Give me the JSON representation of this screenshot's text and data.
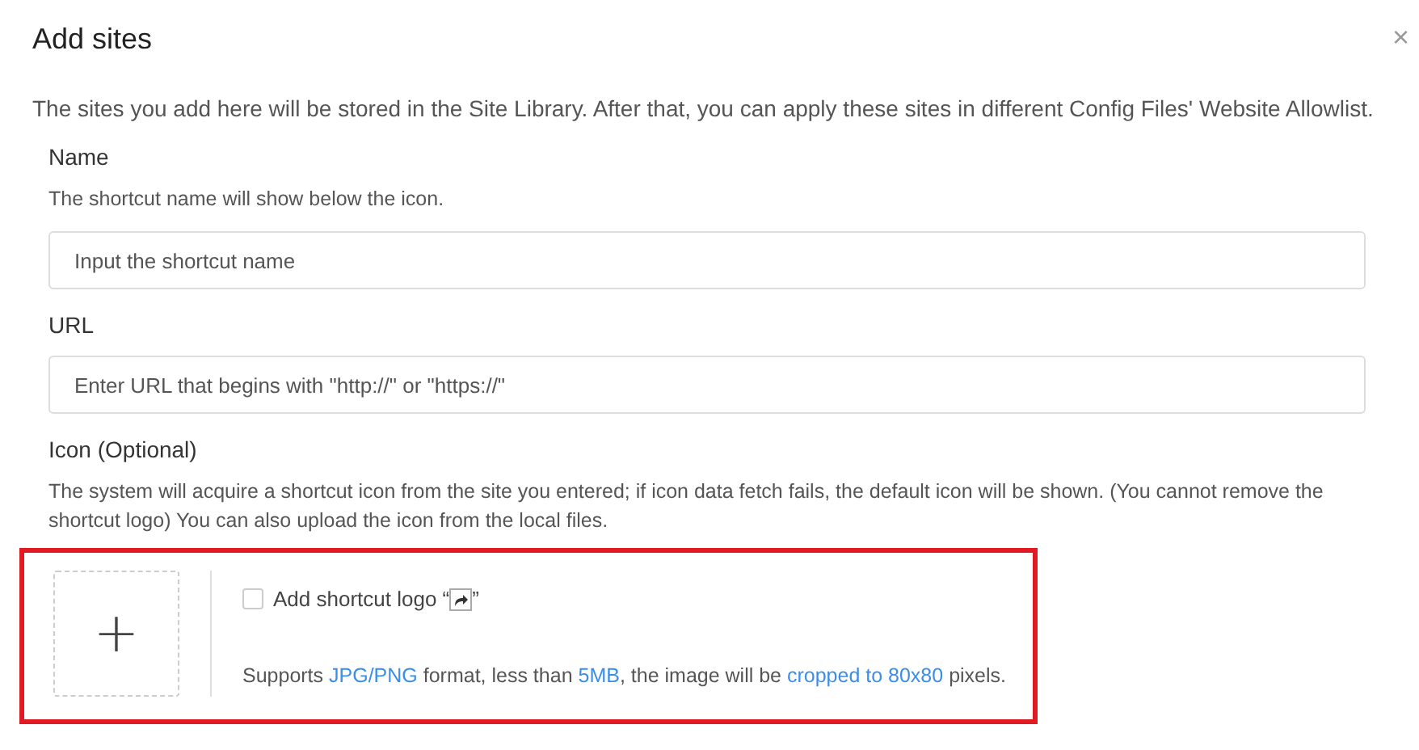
{
  "dialog": {
    "title": "Add sites",
    "close_label": "×",
    "description": "The sites you add here will be stored in the Site Library. After that, you can apply these sites in different Config Files' Website Allowlist.",
    "fields": [
      {
        "label": "Name",
        "hint": "The shortcut name will show below the icon.",
        "placeholder": "Input the shortcut name"
      },
      {
        "label": "URL",
        "placeholder": "Enter URL that begins with \"http://\" or \"https://\""
      }
    ],
    "icon_section": {
      "label": "Icon (Optional)",
      "hint": "The system will acquire a shortcut icon from the site you entered; if icon data fetch fails, the default icon will be shown. (You cannot remove the shortcut logo) You can also upload the icon from the local files.",
      "highlighted": true,
      "upload_symbol": "+",
      "checkbox": {
        "label": "Add shortcut logo “",
        "label_end": "”",
        "checked": false
      },
      "requirements": [
        {
          "text": "Supports ",
          "highlight": false
        },
        {
          "text": "JPG/PNG",
          "highlight": true
        },
        {
          "text": " format, less than ",
          "highlight": false
        },
        {
          "text": "5MB",
          "highlight": true
        },
        {
          "text": ", the image will be ",
          "highlight": false
        },
        {
          "text": "cropped to 80x80",
          "highlight": true
        },
        {
          "text": " pixels.",
          "highlight": false
        }
      ]
    }
  }
}
